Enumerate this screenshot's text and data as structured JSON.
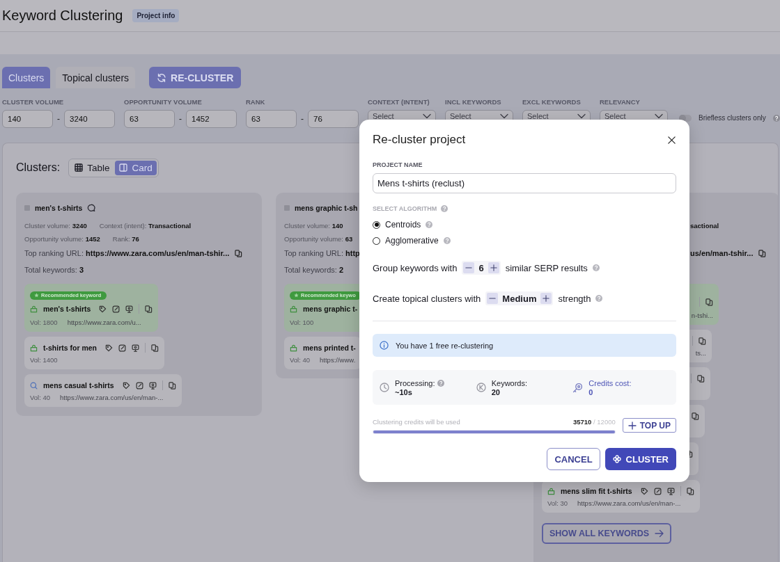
{
  "header": {
    "title": "Keyword Clustering",
    "badge": "Project info"
  },
  "tabs": [
    {
      "label": "Clusters",
      "selected": true
    },
    {
      "label": "Topical clusters",
      "selected": false
    }
  ],
  "recluster_button": "RE-CLUSTER",
  "filters": [
    {
      "kind": "range",
      "label": "CLUSTER VOLUME",
      "min": "140",
      "separator": "-",
      "max": "3240"
    },
    {
      "kind": "range",
      "label": "OPPORTUNITY VOLUME",
      "min": "63",
      "separator": "-",
      "max": "1452"
    },
    {
      "kind": "range",
      "label": "RANK",
      "min": "63",
      "separator": "-",
      "max": "76"
    },
    {
      "kind": "select",
      "label": "CONTEXT (INTENT)",
      "placeholder": "Select"
    },
    {
      "kind": "select",
      "label": "INCL KEYWORDS",
      "placeholder": "Select"
    },
    {
      "kind": "select",
      "label": "EXCL KEYWORDS",
      "placeholder": "Select"
    },
    {
      "kind": "select",
      "label": "RELEVANCY",
      "placeholder": "Select"
    }
  ],
  "briefless_toggle": {
    "label": "Briefless clusters only",
    "on": false
  },
  "clusters_heading": "Clusters:",
  "view_toggle": [
    {
      "label": "Table",
      "kind": "table",
      "selected": false
    },
    {
      "label": "Card",
      "kind": "card",
      "selected": true
    }
  ],
  "clusters": [
    {
      "kind": "full",
      "checked": false,
      "name": "men's t-shirts",
      "stats": [
        [
          {
            "label": "Cluster volume:",
            "value": "3240"
          },
          {
            "label": "Context (intent):",
            "value": "Transactional"
          }
        ],
        [
          {
            "label": "Opportunity volume:",
            "value": "1452"
          },
          {
            "label": "Rank:",
            "value": "76"
          }
        ]
      ],
      "url_label": "Top ranking URL:",
      "url": "https://www.zara.com/us/en/man-tshir...",
      "total_label": "Total keywords:",
      "total": "3",
      "keywords": [
        {
          "recommended": true,
          "badge": "Recommended keyword",
          "kind": "bag",
          "text": "men's t-shirts",
          "vol": "Vol: 1800",
          "url": "https://www.zara.com/u..."
        },
        {
          "recommended": false,
          "kind": "bag",
          "text": "t-shirts for men",
          "vol": "Vol: 1400"
        },
        {
          "recommended": false,
          "kind": "search",
          "text": "mens casual t-shirts",
          "vol": "Vol: 40",
          "url": "https://www.zara.com/us/en/man-..."
        }
      ]
    },
    {
      "kind": "left-part",
      "checked": false,
      "name": "mens graphic t-sh",
      "stats": [
        [
          {
            "label": "Cluster volume:",
            "value": "140"
          }
        ],
        [
          {
            "label": "Opportunity volume:",
            "value": "63"
          }
        ]
      ],
      "url_label": "Top ranking URL:",
      "url": "http",
      "total_label": "Total keywords:",
      "total": "2",
      "keywords": [
        {
          "recommended": true,
          "badge": "Recommended keywo",
          "kind": "bag",
          "text": "mens graphic t-",
          "vol": "Vol: 100"
        },
        {
          "recommended": false,
          "kind": "bag",
          "text": "mens printed t-",
          "vol": "Vol: 40",
          "url": "https://www."
        }
      ]
    },
    {
      "kind": "right-part",
      "stats": [
        [
          {
            "value": "sactional"
          }
        ]
      ],
      "url": "us/en/man-tshir...",
      "keywords": [
        {
          "recommended": true,
          "url": "n-tshi..."
        },
        {
          "recommended": false,
          "url": "ts..."
        },
        {
          "recommended": false
        },
        {
          "recommended": false
        },
        {
          "recommended": false
        },
        {
          "recommended": false,
          "kind": "bag",
          "text": "mens slim fit t-shirts",
          "vol": "Vol: 30",
          "url": "https://www.zara.com/us/en/man-..."
        }
      ],
      "show_all": "SHOW ALL KEYWORDS"
    }
  ],
  "modal": {
    "title": "Re-cluster project",
    "project_name_label": "PROJECT NAME",
    "project_name": "Mens t-shirts (reclust)",
    "algorithm_label": "SELECT ALGORITHM",
    "algorithms": [
      {
        "label": "Centroids",
        "selected": true
      },
      {
        "label": "Agglomerative",
        "selected": false
      }
    ],
    "serp_row": {
      "before": "Group keywords with",
      "value": "6",
      "after": "similar SERP results"
    },
    "topical_row": {
      "before": "Create topical clusters with",
      "value": "Medium",
      "after": "strength"
    },
    "info": "You have 1 free re-clustering",
    "stats": [
      {
        "kind": "time",
        "label": "Processing:",
        "value": "~10s",
        "help": true
      },
      {
        "kind": "keywords",
        "label": "Keywords:",
        "value": "20",
        "help": false
      },
      {
        "kind": "credits",
        "label": "Credits cost:",
        "value": "0",
        "help": false
      }
    ],
    "credits": {
      "label": "Clustering credits will be used",
      "used": "35710",
      "total": "/ 12000",
      "level": 1
    },
    "top_up": "TOP UP",
    "cancel": "CANCEL",
    "submit": "CLUSTER"
  }
}
